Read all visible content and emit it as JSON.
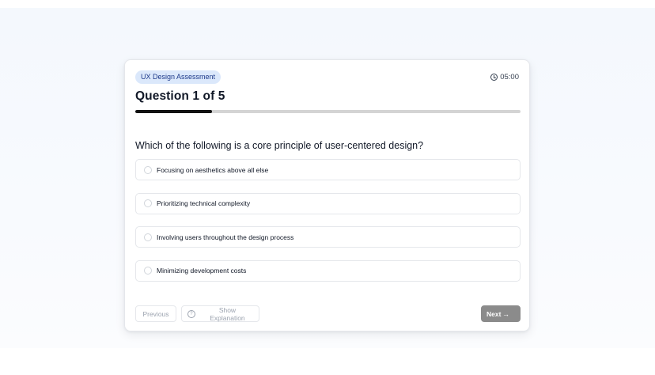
{
  "quiz": {
    "category": "UX Design Assessment",
    "timer": "05:00",
    "question_title": "Question 1 of 5",
    "progress_fraction": 0.2,
    "question_text": "Which of the following is a core principle of user-centered design?",
    "options": [
      {
        "label": "Focusing on aesthetics above all else"
      },
      {
        "label": "Prioritizing technical complexity"
      },
      {
        "label": "Involving users throughout the design process"
      },
      {
        "label": "Minimizing development costs"
      }
    ]
  },
  "footer": {
    "previous_label": "Previous",
    "explanation_label": "Show Explanation",
    "next_label": "Next"
  },
  "icons": {
    "timer": "clock-icon",
    "explanation": "help-circle-icon",
    "next": "arrow-right-icon"
  },
  "colors": {
    "progress_fill": "#111111",
    "badge_bg": "#dbe8fb",
    "next_button": "#8b8b8b"
  }
}
